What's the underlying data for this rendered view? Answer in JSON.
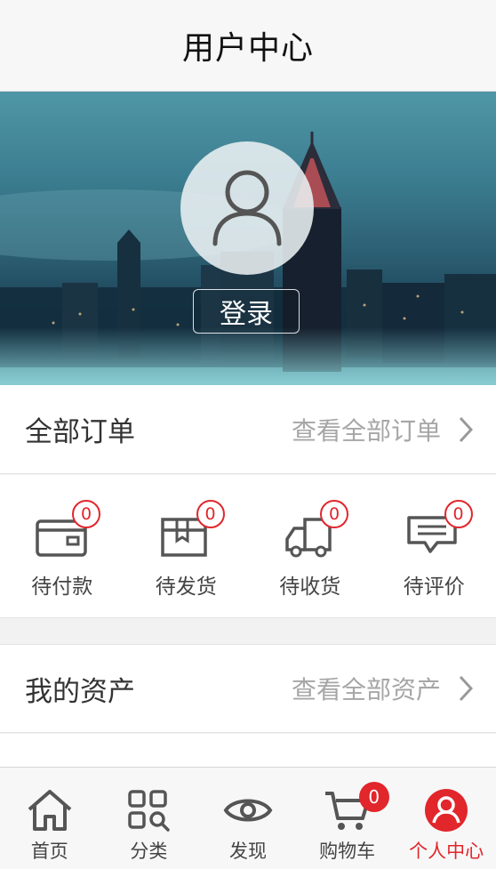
{
  "header": {
    "title": "用户中心"
  },
  "profile": {
    "login_label": "登录"
  },
  "orders": {
    "title": "全部订单",
    "view_all": "查看全部订单",
    "statuses": [
      {
        "label": "待付款",
        "count": "0",
        "icon": "wallet-icon"
      },
      {
        "label": "待发货",
        "count": "0",
        "icon": "package-icon"
      },
      {
        "label": "待收货",
        "count": "0",
        "icon": "truck-icon"
      },
      {
        "label": "待评价",
        "count": "0",
        "icon": "comment-icon"
      }
    ]
  },
  "assets": {
    "title": "我的资产",
    "view_all": "查看全部资产"
  },
  "tabbar": {
    "active_color": "#e1262c",
    "items": [
      {
        "label": "首页",
        "icon": "home-icon"
      },
      {
        "label": "分类",
        "icon": "category-icon"
      },
      {
        "label": "发现",
        "icon": "eye-icon"
      },
      {
        "label": "购物车",
        "icon": "cart-icon",
        "badge": "0"
      },
      {
        "label": "个人中心",
        "icon": "profile-icon",
        "active": true
      }
    ]
  }
}
